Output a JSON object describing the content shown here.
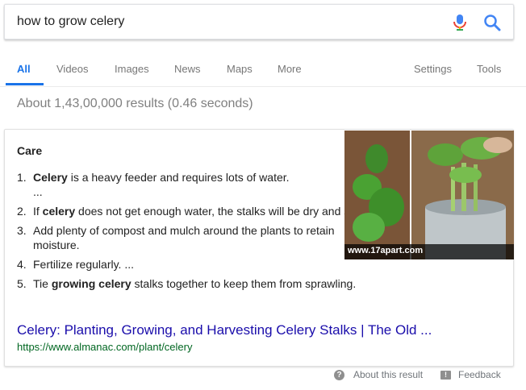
{
  "search": {
    "query": "how to grow celery"
  },
  "tabs": [
    {
      "label": "All"
    },
    {
      "label": "Videos"
    },
    {
      "label": "Images"
    },
    {
      "label": "News"
    },
    {
      "label": "Maps"
    },
    {
      "label": "More"
    }
  ],
  "tools": {
    "settings": "Settings",
    "tools": "Tools"
  },
  "result_stats": "About 1,43,00,000 results (0.46 seconds)",
  "snippet": {
    "title": "Care",
    "items": [
      {
        "num": "1.",
        "pre": "",
        "bold": "Celery",
        "post": " is a heavy feeder and requires lots of water."
      },
      {
        "num": "",
        "pre": "...",
        "bold": "",
        "post": ""
      },
      {
        "num": "2.",
        "pre": "If ",
        "bold": "celery",
        "post": " does not get enough water, the stalks will be dry and small."
      },
      {
        "num": "3.",
        "pre": "Add plenty of compost and mulch around the plants to retain moisture.",
        "bold": "",
        "post": ""
      },
      {
        "num": "4.",
        "pre": "Fertilize regularly. ...",
        "bold": "",
        "post": ""
      },
      {
        "num": "5.",
        "pre": "Tie ",
        "bold": "growing celery",
        "post": " stalks together to keep them from sprawling."
      }
    ],
    "image_caption": "www.17apart.com",
    "link_title": "Celery: Planting, Growing, and Harvesting Celery Stalks | The Old ...",
    "url": "https://www.almanac.com/plant/celery"
  },
  "footer": {
    "about": "About this result",
    "feedback": "Feedback"
  },
  "colors": {
    "link": "#1a0dab",
    "url": "#006621",
    "accent": "#1a73e8"
  }
}
